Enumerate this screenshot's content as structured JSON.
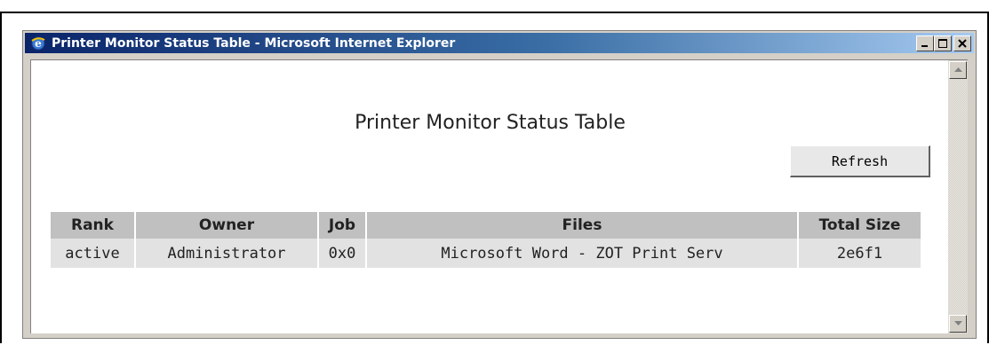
{
  "window": {
    "title": "Printer Monitor Status Table - Microsoft Internet Explorer",
    "minimize_glyph": "_",
    "close_glyph": "✕"
  },
  "page": {
    "heading": "Printer Monitor Status Table",
    "refresh_label": "Refresh"
  },
  "table": {
    "headers": [
      "Rank",
      "Owner",
      "Job",
      "Files",
      "Total Size"
    ],
    "rows": [
      [
        "active",
        "Administrator",
        "0x0",
        "Microsoft Word - ZOT Print Serv",
        "2e6f1"
      ]
    ]
  },
  "colors": {
    "titlebar_start": "#0a246a",
    "titlebar_end": "#a6caf0",
    "header_bg": "#c0c0c0",
    "row_bg": "#e2e2e2"
  }
}
